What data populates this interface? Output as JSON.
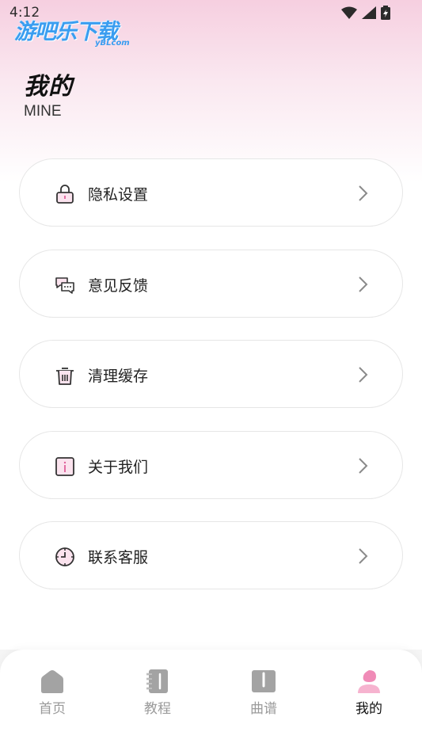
{
  "status_bar": {
    "time": "4:12"
  },
  "watermark": {
    "main": "游吧乐下载",
    "sub": "yBLcom"
  },
  "header": {
    "title": "我的",
    "subtitle": "MINE"
  },
  "menu": [
    {
      "label": "隐私设置",
      "icon": "lock-icon"
    },
    {
      "label": "意见反馈",
      "icon": "chat-bubbles-icon"
    },
    {
      "label": "清理缓存",
      "icon": "trash-icon"
    },
    {
      "label": "关于我们",
      "icon": "info-icon"
    },
    {
      "label": "联系客服",
      "icon": "clock-icon"
    }
  ],
  "tabs": [
    {
      "label": "首页",
      "icon": "home-icon",
      "active": false
    },
    {
      "label": "教程",
      "icon": "notebook-icon",
      "active": false
    },
    {
      "label": "曲谱",
      "icon": "book-icon",
      "active": false
    },
    {
      "label": "我的",
      "icon": "user-icon",
      "active": true
    }
  ],
  "colors": {
    "accent": "#f08bb7",
    "inactive_tab": "#9a9a9a",
    "header_gradient_top": "#f6cfe0"
  }
}
